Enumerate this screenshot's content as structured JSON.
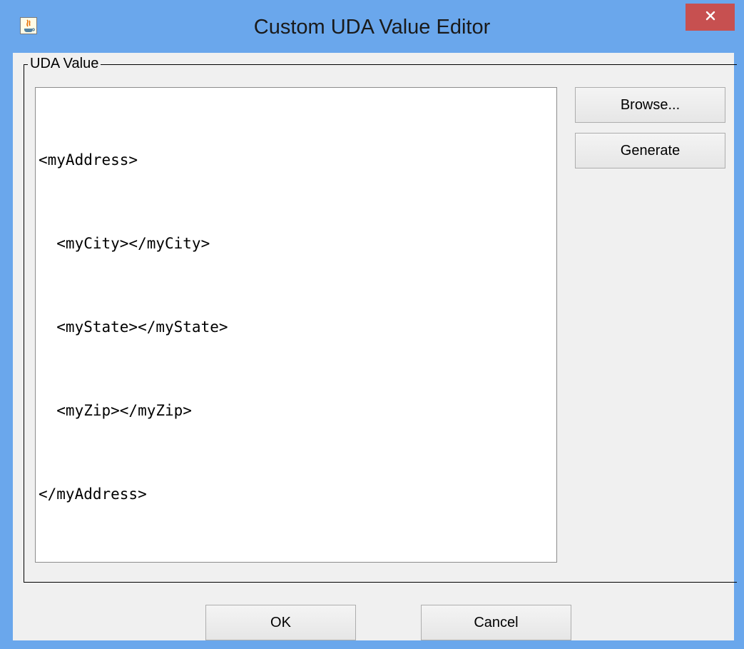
{
  "window": {
    "title": "Custom UDA Value Editor",
    "close_glyph": "✕",
    "accent": "#6aa7ec",
    "close_color": "#c75050"
  },
  "group": {
    "label": "UDA Value"
  },
  "editor": {
    "lines": [
      "<myAddress>",
      "  <myCity></myCity>",
      "  <myState></myState>",
      "  <myZip></myZip>",
      "</myAddress>"
    ]
  },
  "buttons": {
    "browse": "Browse...",
    "generate": "Generate",
    "ok": "OK",
    "cancel": "Cancel"
  },
  "icons": {
    "app": "java-coffee-cup-icon",
    "close": "close-icon"
  }
}
